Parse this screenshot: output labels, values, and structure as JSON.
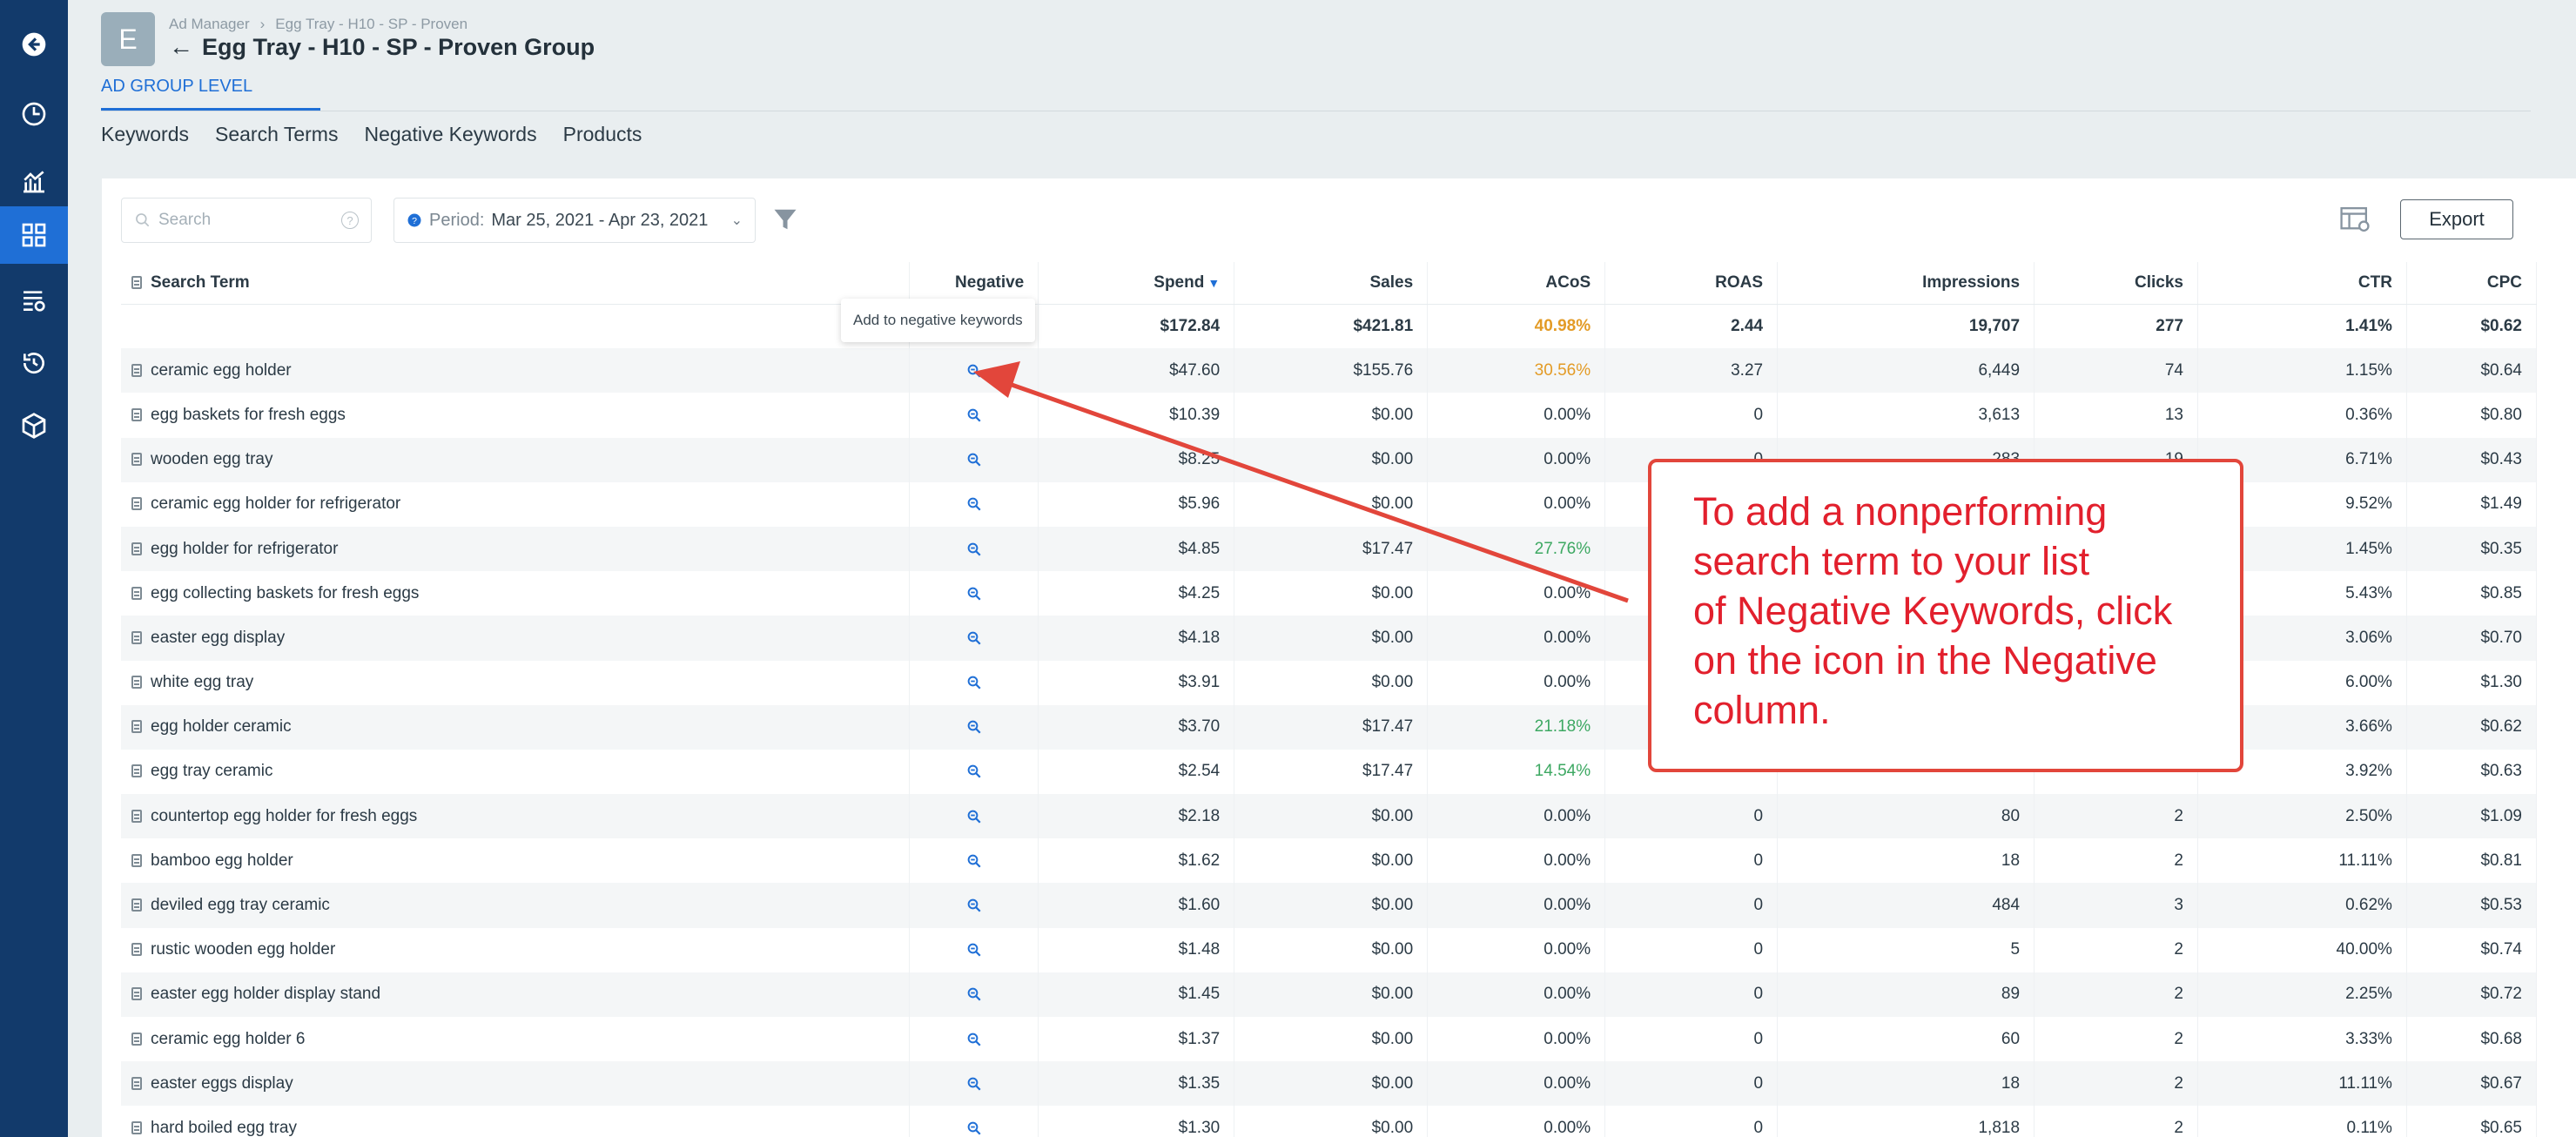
{
  "breadcrumb": {
    "root": "Ad Manager",
    "separator": "›",
    "current": "Egg Tray - H10 - SP - Proven"
  },
  "header": {
    "avatar_letter": "E",
    "back_arrow": "←",
    "title": "Egg Tray - H10 - SP - Proven Group",
    "level": "AD GROUP LEVEL"
  },
  "tabs": [
    "Keywords",
    "Search Terms",
    "Negative Keywords",
    "Products"
  ],
  "toolbar": {
    "search_placeholder": "Search",
    "search_help": "?",
    "period_label": "Period:",
    "period_value": "Mar 25, 2021 - Apr 23, 2021",
    "export_label": "Export"
  },
  "table": {
    "columns": {
      "term": "Search Term",
      "negative": "Negative",
      "spend": "Spend",
      "sales": "Sales",
      "acos": "ACoS",
      "roas": "ROAS",
      "impressions": "Impressions",
      "clicks": "Clicks",
      "ctr": "CTR",
      "cpc": "CPC"
    },
    "sort_indicator": "▼",
    "totals": {
      "spend": "$172.84",
      "sales": "$421.81",
      "acos": "40.98%",
      "roas": "2.44",
      "impressions": "19,707",
      "clicks": "277",
      "ctr": "1.41%",
      "cpc": "$0.62"
    },
    "rows": [
      {
        "term": "ceramic egg holder",
        "spend": "$47.60",
        "sales": "$155.76",
        "acos": "30.56%",
        "acos_color": "orange",
        "roas": "3.27",
        "impressions": "6,449",
        "clicks": "74",
        "ctr": "1.15%",
        "cpc": "$0.64"
      },
      {
        "term": "egg baskets for fresh eggs",
        "spend": "$10.39",
        "sales": "$0.00",
        "acos": "0.00%",
        "roas": "0",
        "impressions": "3,613",
        "clicks": "13",
        "ctr": "0.36%",
        "cpc": "$0.80"
      },
      {
        "term": "wooden egg tray",
        "spend": "$8.25",
        "sales": "$0.00",
        "acos": "0.00%",
        "roas": "0",
        "impressions": "283",
        "clicks": "19",
        "ctr": "6.71%",
        "cpc": "$0.43"
      },
      {
        "term": "ceramic egg holder for refrigerator",
        "spend": "$5.96",
        "sales": "$0.00",
        "acos": "0.00%",
        "roas": "",
        "impressions": "",
        "clicks": "",
        "ctr": "9.52%",
        "cpc": "$1.49"
      },
      {
        "term": "egg holder for refrigerator",
        "spend": "$4.85",
        "sales": "$17.47",
        "acos": "27.76%",
        "acos_color": "green",
        "roas": "",
        "impressions": "",
        "clicks": "",
        "ctr": "1.45%",
        "cpc": "$0.35"
      },
      {
        "term": "egg collecting baskets for fresh eggs",
        "spend": "$4.25",
        "sales": "$0.00",
        "acos": "0.00%",
        "roas": "",
        "impressions": "",
        "clicks": "",
        "ctr": "5.43%",
        "cpc": "$0.85"
      },
      {
        "term": "easter egg display",
        "spend": "$4.18",
        "sales": "$0.00",
        "acos": "0.00%",
        "roas": "",
        "impressions": "",
        "clicks": "",
        "ctr": "3.06%",
        "cpc": "$0.70"
      },
      {
        "term": "white egg tray",
        "spend": "$3.91",
        "sales": "$0.00",
        "acos": "0.00%",
        "roas": "",
        "impressions": "",
        "clicks": "",
        "ctr": "6.00%",
        "cpc": "$1.30"
      },
      {
        "term": "egg holder ceramic",
        "spend": "$3.70",
        "sales": "$17.47",
        "acos": "21.18%",
        "acos_color": "green",
        "roas": "",
        "impressions": "",
        "clicks": "",
        "ctr": "3.66%",
        "cpc": "$0.62"
      },
      {
        "term": "egg tray ceramic",
        "spend": "$2.54",
        "sales": "$17.47",
        "acos": "14.54%",
        "acos_color": "green",
        "roas": "",
        "impressions": "",
        "clicks": "",
        "ctr": "3.92%",
        "cpc": "$0.63"
      },
      {
        "term": "countertop egg holder for fresh eggs",
        "spend": "$2.18",
        "sales": "$0.00",
        "acos": "0.00%",
        "roas": "0",
        "impressions": "80",
        "clicks": "2",
        "ctr": "2.50%",
        "cpc": "$1.09"
      },
      {
        "term": "bamboo egg holder",
        "spend": "$1.62",
        "sales": "$0.00",
        "acos": "0.00%",
        "roas": "0",
        "impressions": "18",
        "clicks": "2",
        "ctr": "11.11%",
        "cpc": "$0.81"
      },
      {
        "term": "deviled egg tray ceramic",
        "spend": "$1.60",
        "sales": "$0.00",
        "acos": "0.00%",
        "roas": "0",
        "impressions": "484",
        "clicks": "3",
        "ctr": "0.62%",
        "cpc": "$0.53"
      },
      {
        "term": "rustic wooden egg holder",
        "spend": "$1.48",
        "sales": "$0.00",
        "acos": "0.00%",
        "roas": "0",
        "impressions": "5",
        "clicks": "2",
        "ctr": "40.00%",
        "cpc": "$0.74"
      },
      {
        "term": "easter egg holder display stand",
        "spend": "$1.45",
        "sales": "$0.00",
        "acos": "0.00%",
        "roas": "0",
        "impressions": "89",
        "clicks": "2",
        "ctr": "2.25%",
        "cpc": "$0.72"
      },
      {
        "term": "ceramic egg holder 6",
        "spend": "$1.37",
        "sales": "$0.00",
        "acos": "0.00%",
        "roas": "0",
        "impressions": "60",
        "clicks": "2",
        "ctr": "3.33%",
        "cpc": "$0.68"
      },
      {
        "term": "easter eggs display",
        "spend": "$1.35",
        "sales": "$0.00",
        "acos": "0.00%",
        "roas": "0",
        "impressions": "18",
        "clicks": "2",
        "ctr": "11.11%",
        "cpc": "$0.67"
      },
      {
        "term": "hard boiled egg tray",
        "spend": "$1.30",
        "sales": "$0.00",
        "acos": "0.00%",
        "roas": "0",
        "impressions": "1,818",
        "clicks": "2",
        "ctr": "0.11%",
        "cpc": "$0.65"
      }
    ]
  },
  "tooltip": "Add to negative keywords",
  "annotation": {
    "lines": [
      "To add a nonperforming",
      "search term to your list",
      "of Negative Keywords, click",
      "on the icon in the Negative",
      "column."
    ],
    "color": "#e2202d"
  },
  "colors": {
    "sidebar": "#123a6b",
    "accent": "#1f6fd6",
    "acos_orange": "#e39b26",
    "acos_green": "#3da862",
    "annotation_border": "#e2463b"
  },
  "sidebar_icons": [
    "back-circle-icon",
    "clock-icon",
    "analytics-icon",
    "dashboard-icon",
    "list-settings-icon",
    "history-icon",
    "box-icon"
  ]
}
